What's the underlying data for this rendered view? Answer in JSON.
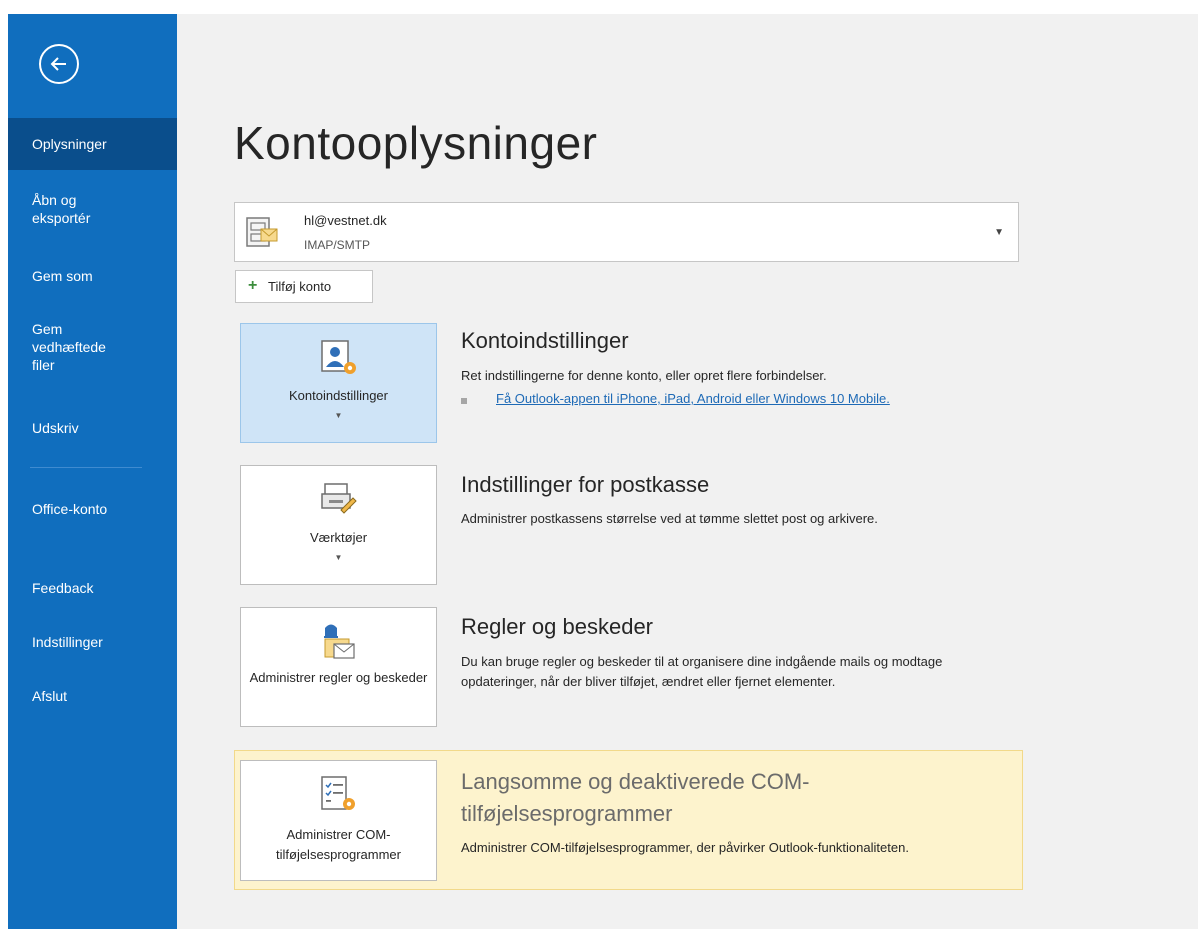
{
  "sidebar": {
    "items": [
      {
        "label": "Oplysninger"
      },
      {
        "label": "Åbn og eksportér"
      },
      {
        "label": "Gem som"
      },
      {
        "label": "Gem vedhæftede filer"
      },
      {
        "label": "Udskriv"
      },
      {
        "label": "Office-konto"
      },
      {
        "label": "Feedback"
      },
      {
        "label": "Indstillinger"
      },
      {
        "label": "Afslut"
      }
    ]
  },
  "main": {
    "title": "Kontooplysninger",
    "account": {
      "email": "hl@vestnet.dk",
      "type": "IMAP/SMTP"
    },
    "add_account_label": "Tilføj konto",
    "sections": [
      {
        "tile_label": "Kontoindstillinger",
        "title": "Kontoindstillinger",
        "desc": "Ret indstillingerne for denne konto, eller opret flere forbindelser.",
        "link": "Få Outlook-appen til iPhone, iPad, Android eller Windows 10 Mobile."
      },
      {
        "tile_label": "Værktøjer",
        "title": "Indstillinger for postkasse",
        "desc": "Administrer postkassens størrelse ved at tømme slettet post og arkivere."
      },
      {
        "tile_label": "Administrer regler og beskeder",
        "title": "Regler og beskeder",
        "desc": "Du kan bruge regler og beskeder til at organisere dine indgående mails og modtage opdateringer, når der bliver tilføjet, ændret eller fjernet elementer."
      },
      {
        "tile_label": "Administrer COM-tilføjelsesprogrammer",
        "title": "Langsomme og deaktiverede COM-tilføjelsesprogrammer",
        "desc": "Administrer COM-tilføjelsesprogrammer, der påvirker Outlook-funktionaliteten."
      }
    ]
  },
  "colors": {
    "sidebar": "#106ebe",
    "sidebar_active": "#0a4e8c",
    "selected_tile": "#cfe4f7",
    "highlight": "#fdf3cd",
    "link": "#1e6ab6"
  }
}
